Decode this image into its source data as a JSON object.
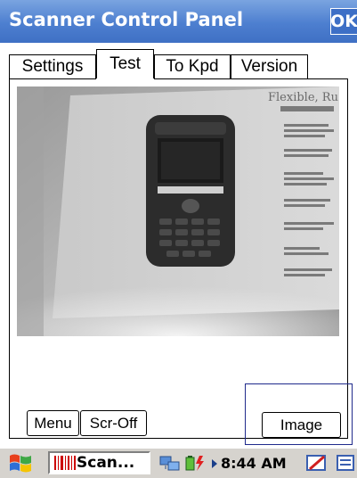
{
  "window": {
    "title": "Scanner Control Panel",
    "ok_label": "OK"
  },
  "tabs": [
    {
      "label": "Settings",
      "active": false
    },
    {
      "label": "Test",
      "active": true
    },
    {
      "label": "To Kpd",
      "active": false
    },
    {
      "label": "Version",
      "active": false
    }
  ],
  "preview": {
    "heading_text": "Flexible, Ru"
  },
  "buttons": {
    "menu_label": "Menu",
    "scr_off_label": "Scr-Off",
    "image_label": "Image"
  },
  "taskbar": {
    "start_icon": "windows-flag-icon",
    "task_label": "Scan...",
    "task_icon": "barcode-icon",
    "tray_icons": [
      "network-icon",
      "battery-icon",
      "expand-arrow-icon"
    ],
    "clock": "8:44 AM",
    "extra_icons": [
      "input-panel-icon",
      "keyboard-icon"
    ]
  },
  "colors": {
    "titlebar": "#4d7fd0",
    "title_text": "#ffffff",
    "taskbar": "#d6d3ce",
    "image_frame_border": "#1f2a8c"
  }
}
